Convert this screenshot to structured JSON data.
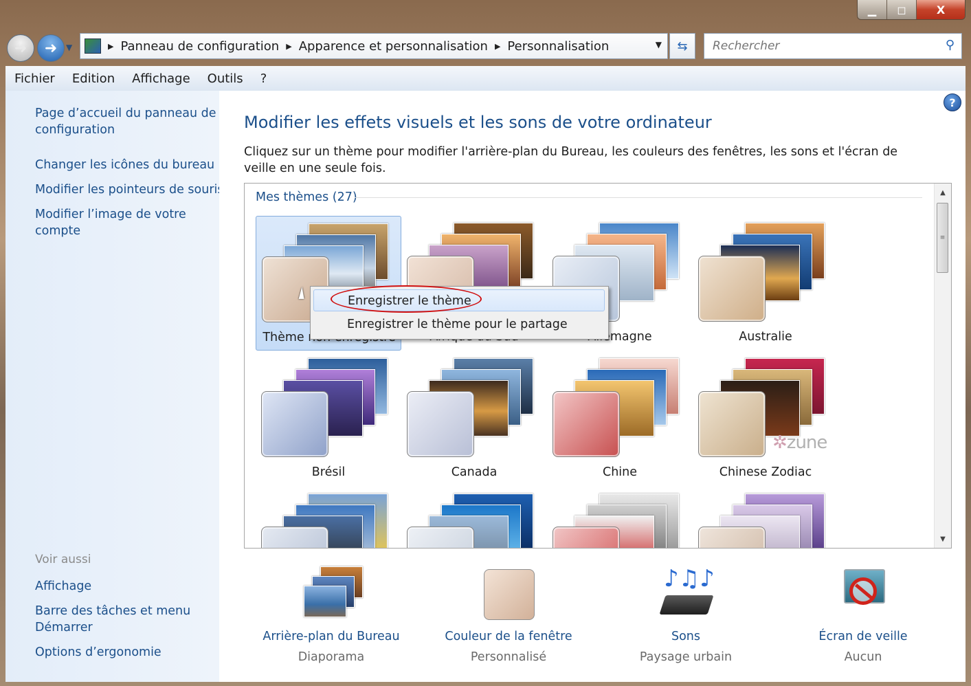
{
  "window": {
    "caption_minimize": "▁",
    "caption_maximize": "◻",
    "caption_close": "X"
  },
  "address": {
    "crumbs": [
      "Panneau de configuration",
      "Apparence et personnalisation",
      "Personnalisation"
    ]
  },
  "search": {
    "placeholder": "Rechercher"
  },
  "menu": [
    "Fichier",
    "Edition",
    "Affichage",
    "Outils",
    "?"
  ],
  "sidebar": {
    "links": [
      "Page d’accueil du panneau de configuration",
      "Changer les icônes du bureau",
      "Modifier les pointeurs de souris",
      "Modifier l’image de votre compte"
    ],
    "see_also_heading": "Voir aussi",
    "see_also": [
      "Affichage",
      "Barre des tâches et menu Démarrer",
      "Options d’ergonomie"
    ]
  },
  "main": {
    "title": "Modifier les effets visuels et les sons de votre ordinateur",
    "description": "Cliquez sur un thème pour modifier l'arrière-plan du Bureau, les couleurs des fenêtres, les sons et l'écran de veille en une seule fois.",
    "group_label": "Mes thèmes (27)",
    "themes": [
      {
        "label": "Thème non enregistré",
        "selected": true
      },
      {
        "label": "Afrique du Sud"
      },
      {
        "label": "Allemagne"
      },
      {
        "label": "Australie"
      },
      {
        "label": "Brésil"
      },
      {
        "label": "Canada"
      },
      {
        "label": "Chine"
      },
      {
        "label": "Chinese Zodiac"
      }
    ],
    "zune_logo": "zune"
  },
  "context_menu": {
    "items": [
      "Enregistrer le thème",
      "Enregistrer le thème pour le partage"
    ]
  },
  "bottom": [
    {
      "title": "Arrière-plan du Bureau",
      "subtitle": "Diaporama",
      "icon": "wallpaper-icon"
    },
    {
      "title": "Couleur de la fenêtre",
      "subtitle": "Personnalisé",
      "icon": "window-color-icon"
    },
    {
      "title": "Sons",
      "subtitle": "Paysage urbain",
      "icon": "sounds-icon"
    },
    {
      "title": "Écran de veille",
      "subtitle": "Aucun",
      "icon": "screensaver-icon"
    }
  ],
  "colors": {
    "link": "#1b4f8a",
    "sidebar_bg": "#e3edf9",
    "selection": "#c5dcf7",
    "highlight_ring": "#d01010"
  }
}
